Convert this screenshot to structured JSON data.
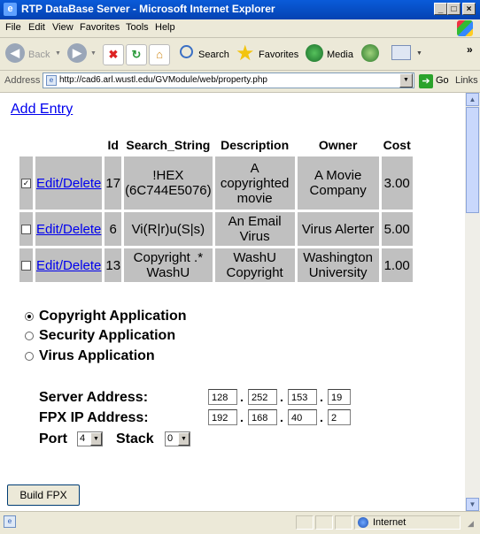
{
  "window": {
    "title": "RTP DataBase Server - Microsoft Internet Explorer",
    "min": "_",
    "max": "□",
    "close": "×"
  },
  "menu": [
    "File",
    "Edit",
    "View",
    "Favorites",
    "Tools",
    "Help"
  ],
  "toolbar": {
    "back": "Back",
    "search": "Search",
    "favorites": "Favorites",
    "media": "Media",
    "more": "»"
  },
  "address": {
    "label": "Address",
    "url": "http://cad6.arl.wustl.edu/GVModule/web/property.php",
    "go": "Go",
    "links": "Links"
  },
  "page": {
    "add_entry": "Add Entry",
    "table": {
      "headers": [
        "Id",
        "Search_String",
        "Description",
        "Owner",
        "Cost"
      ],
      "rows": [
        {
          "checked": true,
          "action": "Edit/Delete",
          "id": "17",
          "search": "!HEX (6C744E5076)",
          "desc": "A copyrighted movie",
          "owner": "A Movie Company",
          "cost": "3.00"
        },
        {
          "checked": false,
          "action": "Edit/Delete",
          "id": "6",
          "search": "Vi(R|r)u(S|s)",
          "desc": "An Email Virus",
          "owner": "Virus Alerter",
          "cost": "5.00"
        },
        {
          "checked": false,
          "action": "Edit/Delete",
          "id": "13",
          "search": "Copyright .* WashU",
          "desc": "WashU Copyright",
          "owner": "Washington University",
          "cost": "1.00"
        }
      ]
    },
    "radios": [
      {
        "label": "Copyright Application",
        "selected": true
      },
      {
        "label": "Security Application",
        "selected": false
      },
      {
        "label": "Virus Application",
        "selected": false
      }
    ],
    "server_address": {
      "label": "Server Address:",
      "octets": [
        "128",
        "252",
        "153",
        "19"
      ]
    },
    "fpx_ip": {
      "label": "FPX IP Address:",
      "octets": [
        "192",
        "168",
        "40",
        "2"
      ]
    },
    "port": {
      "label": "Port",
      "value": "4"
    },
    "stack": {
      "label": "Stack",
      "value": "0"
    },
    "build_button": "Build FPX"
  },
  "status": {
    "zone": "Internet"
  }
}
